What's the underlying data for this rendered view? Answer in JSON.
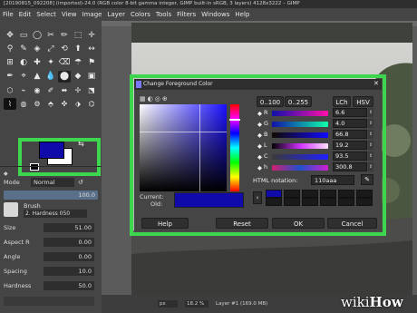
{
  "window": {
    "title": "[20190815_092208] (imported)-24.0 (RGB color 8-bit gamma integer, GIMP built-in sRGB, 3 layers) 4128x3222 – GIMP"
  },
  "menu": [
    "File",
    "Edit",
    "Select",
    "View",
    "Image",
    "Layer",
    "Colors",
    "Tools",
    "Filters",
    "Windows",
    "Help"
  ],
  "colors": {
    "foreground": "#110aaa",
    "background": "#ffffff",
    "highlight": "#3fd64f"
  },
  "tool_options": {
    "mode_label": "Mode",
    "mode_value": "Normal",
    "opacity_label": "Opacity",
    "opacity_value": "100.0",
    "opacity_fraction": 1.0,
    "brush_label": "Brush",
    "brush_value": "2. Hardness 050",
    "size_label": "Size",
    "size_value": "51.00",
    "aspect_label": "Aspect R",
    "aspect_value": "0.00",
    "angle_label": "Angle",
    "angle_value": "0.00",
    "spacing_label": "Spacing",
    "spacing_value": "10.0",
    "hardness_label": "Hardness",
    "hardness_value": "50.0"
  },
  "dialog": {
    "title": "Change Foreground Color",
    "range_buttons": [
      "0..100",
      "0..255"
    ],
    "model_buttons": [
      "LCh",
      "HSV"
    ],
    "channels": [
      {
        "label": "R",
        "value": "6.6"
      },
      {
        "label": "G",
        "value": "4.0"
      },
      {
        "label": "B",
        "value": "66.8"
      },
      {
        "label": "L",
        "value": "19.2"
      },
      {
        "label": "C",
        "value": "93.5"
      },
      {
        "label": "h",
        "value": "300.8"
      }
    ],
    "current_label": "Current:",
    "old_label": "Old:",
    "html_notation_label": "HTML notation:",
    "html_value": "110aaa",
    "buttons": {
      "help": "Help",
      "reset": "Reset",
      "ok": "OK",
      "cancel": "Cancel"
    }
  },
  "statusbar": {
    "unit": "px",
    "zoom": "18.2 %",
    "layer": "Layer #1 (169.0 MB)"
  },
  "watermark": "wikiHow"
}
